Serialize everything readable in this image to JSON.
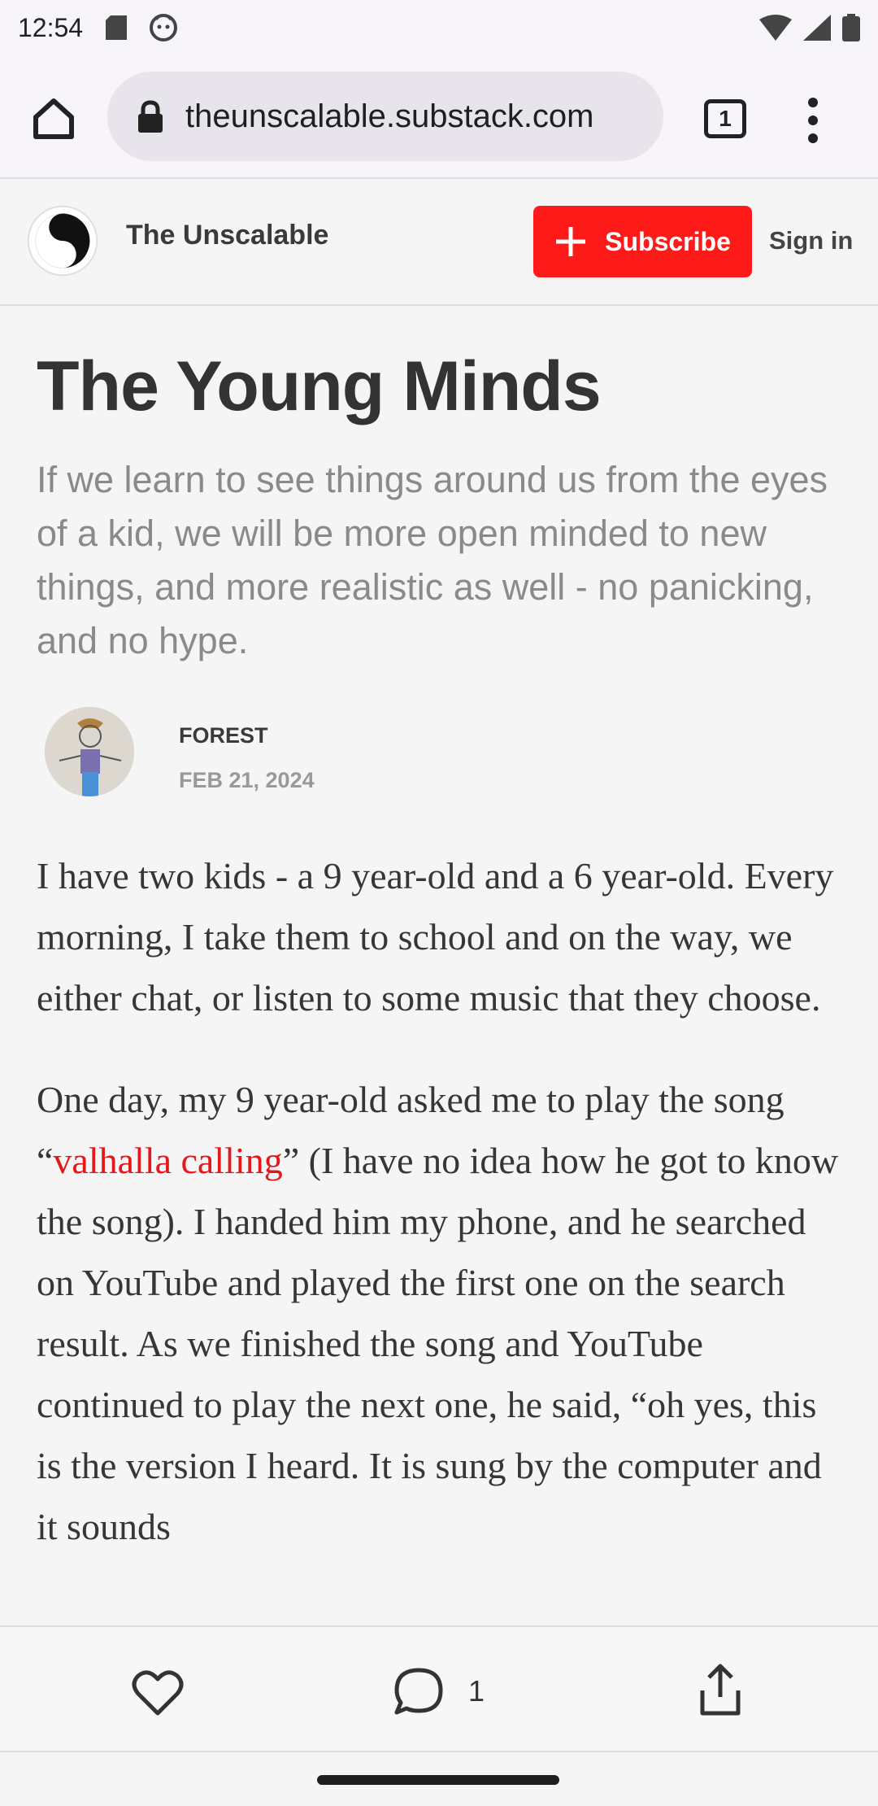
{
  "status_bar": {
    "time": "12:54"
  },
  "browser": {
    "url": "theunscalable.substack.com",
    "tab_count": "1"
  },
  "site": {
    "name": "The Unscalable",
    "subscribe_label": "Subscribe",
    "signin_label": "Sign in"
  },
  "article": {
    "title": "The Young Minds",
    "subtitle": "If we learn to see things around us from the eyes of a kid, we will be more open minded to new things, and more realistic as well - no panicking, and no hype.",
    "author": "FOREST",
    "date": "FEB 21, 2024",
    "paragraph1": "I have two kids - a 9 year-old and a 6 year-old. Every morning, I take them to school and on the way, we either chat, or listen to some music that they choose.",
    "paragraph2_before": "One day, my 9 year-old asked me to play the song “",
    "paragraph2_link": "valhalla calling",
    "paragraph2_after": "” (I have no idea how he got to know the song). I handed him my phone, and he searched on YouTube and played the first one on the search result. As we finished the song and YouTube continued to play the next one, he said, “oh yes, this is the version I heard. It is sung by the computer and it sounds"
  },
  "actions": {
    "comment_count": "1"
  },
  "colors": {
    "accent": "#ff1a1a",
    "link": "#e4171b"
  }
}
